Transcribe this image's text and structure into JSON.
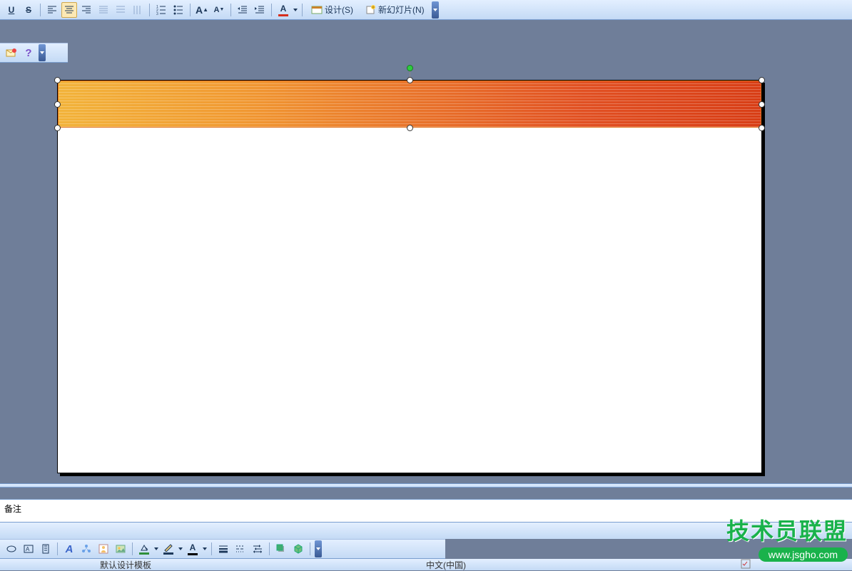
{
  "toolbar1": {
    "underline": "U",
    "strike": "S",
    "fontA": "A",
    "fontA2": "A",
    "fontColorLetter": "A",
    "design_label": "设计(S)",
    "new_slide_label": "新幻灯片(N)"
  },
  "toolbar2": {
    "help": "?"
  },
  "notes": {
    "text": "备注"
  },
  "drawbar": {
    "autoshapes_letter": "A",
    "fontcolor_letter": "A"
  },
  "statusbar": {
    "template": "默认设计模板",
    "lang": "中文(中国)"
  },
  "watermark": {
    "title": "技术员联盟",
    "url": "www.jsgho.com"
  },
  "colors": {
    "fontred": "#d62f1e",
    "fill": "#2f8f3a",
    "line": "#1e395b",
    "black": "#000"
  }
}
